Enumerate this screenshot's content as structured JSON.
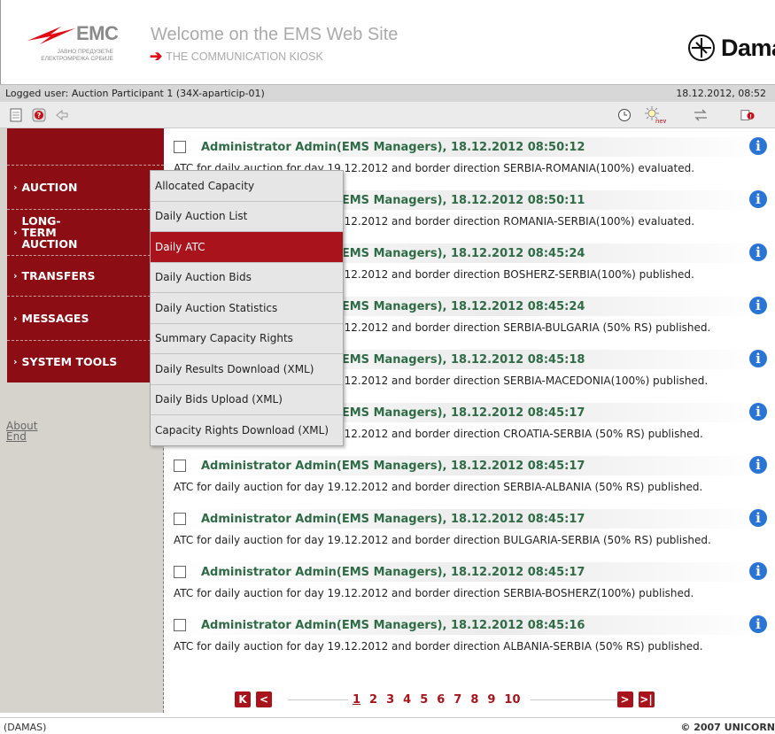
{
  "header": {
    "emc_logo_text": "EMC",
    "emc_subtitle": "ЈАВНО ПРЕДУЗЕЋЕ ЕЛЕКТРОМРЕЖА СРБИЈЕ",
    "welcome": "Welcome on the EMS Web Site",
    "kiosk": "THE COMMUNICATION KIOSK",
    "damas": "Damas"
  },
  "userbar": {
    "user": "Logged user: Auction Participant 1 (34X-aparticip-01)",
    "datetime": "18.12.2012, 08:52"
  },
  "toolbar": {
    "left_icons": [
      "document-icon",
      "help-icon",
      "back-arrow-icon"
    ],
    "right_icons": [
      "clock-icon",
      "new-sun-icon",
      "transfer-arrows-icon",
      "alert-book-icon"
    ],
    "new_badge": "new"
  },
  "leftnav": {
    "items": [
      {
        "label": "AUCTION"
      },
      {
        "label": "LONG-TERM AUCTION"
      },
      {
        "label": "TRANSFERS"
      },
      {
        "label": "MESSAGES"
      },
      {
        "label": "SYSTEM TOOLS"
      }
    ],
    "links": [
      {
        "label": "About"
      },
      {
        "label": "End"
      }
    ]
  },
  "dropdown": {
    "items": [
      {
        "label": "Allocated Capacity",
        "active": false
      },
      {
        "label": "Daily Auction List",
        "active": false
      },
      {
        "label": "Daily ATC",
        "active": true
      },
      {
        "label": "Daily Auction Bids",
        "active": false
      },
      {
        "label": "Daily Auction Statistics",
        "active": false
      },
      {
        "label": "Summary Capacity Rights",
        "active": false
      },
      {
        "label": "Daily Results Download (XML)",
        "active": false
      },
      {
        "label": "Daily Bids Upload (XML)",
        "active": false
      },
      {
        "label": "Capacity Rights Download (XML)",
        "active": false
      }
    ]
  },
  "messages": [
    {
      "title": "Administrator Admin(EMS Managers), 18.12.2012 08:50:12",
      "body": "ATC for daily auction for day 19.12.2012 and border direction SERBIA-ROMANIA(100%) evaluated."
    },
    {
      "title": "Administrator Admin(EMS Managers), 18.12.2012 08:50:11",
      "body": "ATC for daily auction for day 19.12.2012 and border direction ROMANIA-SERBIA(100%) evaluated."
    },
    {
      "title": "Administrator Admin(EMS Managers), 18.12.2012 08:45:24",
      "body": "ATC for daily auction for day 19.12.2012 and border direction BOSHERZ-SERBIA(100%) published."
    },
    {
      "title": "Administrator Admin(EMS Managers), 18.12.2012 08:45:24",
      "body": "ATC for daily auction for day 19.12.2012 and border direction SERBIA-BULGARIA (50% RS) published."
    },
    {
      "title": "Administrator Admin(EMS Managers), 18.12.2012 08:45:18",
      "body": "ATC for daily auction for day 19.12.2012 and border direction SERBIA-MACEDONIA(100%) published."
    },
    {
      "title": "Administrator Admin(EMS Managers), 18.12.2012 08:45:17",
      "body": "ATC for daily auction for day 19.12.2012 and border direction CROATIA-SERBIA (50% RS) published."
    },
    {
      "title": "Administrator Admin(EMS Managers), 18.12.2012 08:45:17",
      "body": "ATC for daily auction for day 19.12.2012 and border direction SERBIA-ALBANIA (50% RS) published."
    },
    {
      "title": "Administrator Admin(EMS Managers), 18.12.2012 08:45:17",
      "body": "ATC for daily auction for day 19.12.2012 and border direction BULGARIA-SERBIA (50% RS) published."
    },
    {
      "title": "Administrator Admin(EMS Managers), 18.12.2012 08:45:17",
      "body": "ATC for daily auction for day 19.12.2012 and border direction SERBIA-BOSHERZ(100%) published."
    },
    {
      "title": "Administrator Admin(EMS Managers), 18.12.2012 08:45:16",
      "body": "ATC for daily auction for day 19.12.2012 and border direction ALBANIA-SERBIA (50% RS) published."
    }
  ],
  "pager": {
    "first": "K",
    "prev": "<",
    "next": ">",
    "last": ">|",
    "pages": [
      "1",
      "2",
      "3",
      "4",
      "5",
      "6",
      "7",
      "8",
      "9",
      "10"
    ],
    "current": "1"
  },
  "footer": {
    "left": "(DAMAS)",
    "right": "© 2007 UNICORN"
  },
  "colors": {
    "brand_red": "#a9131b",
    "nav_red": "#8c0d14",
    "message_title_green": "#2f6b47",
    "info_blue": "#2a75d4"
  }
}
